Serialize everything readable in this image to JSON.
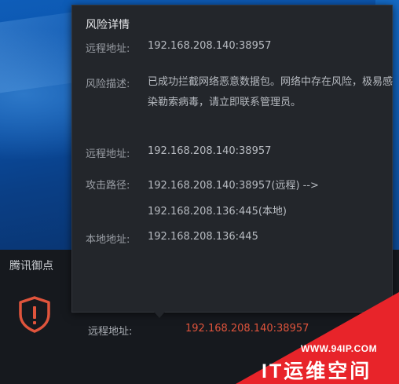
{
  "popup": {
    "title": "风险详情",
    "remote_label_1": "远程地址:",
    "remote_value_1": "192.168.208.140:38957",
    "desc_label": "风险描述:",
    "desc_value": "已成功拦截网络恶意数据包。网络中存在风险，极易感染勒索病毒，请立即联系管理员。",
    "remote_label_2": "远程地址:",
    "remote_value_2": "192.168.208.140:38957",
    "attack_label": "攻击路径:",
    "attack_line_1": "192.168.208.140:38957(远程) -->",
    "attack_line_2": "192.168.208.136:445(本地)",
    "local_label": "本地地址:",
    "local_value": "192.168.208.136:445"
  },
  "notification": {
    "title": "腾讯御点",
    "remote_label": "远程地址:",
    "remote_value": "192.168.208.140:38957",
    "icon": "shield-warning-icon"
  },
  "watermark": {
    "url": "WWW.94IP.COM",
    "name": "IT运维空间"
  },
  "colors": {
    "alert_red": "#e0543c",
    "watermark_red": "#e8242a",
    "popup_bg": "#23262b"
  }
}
